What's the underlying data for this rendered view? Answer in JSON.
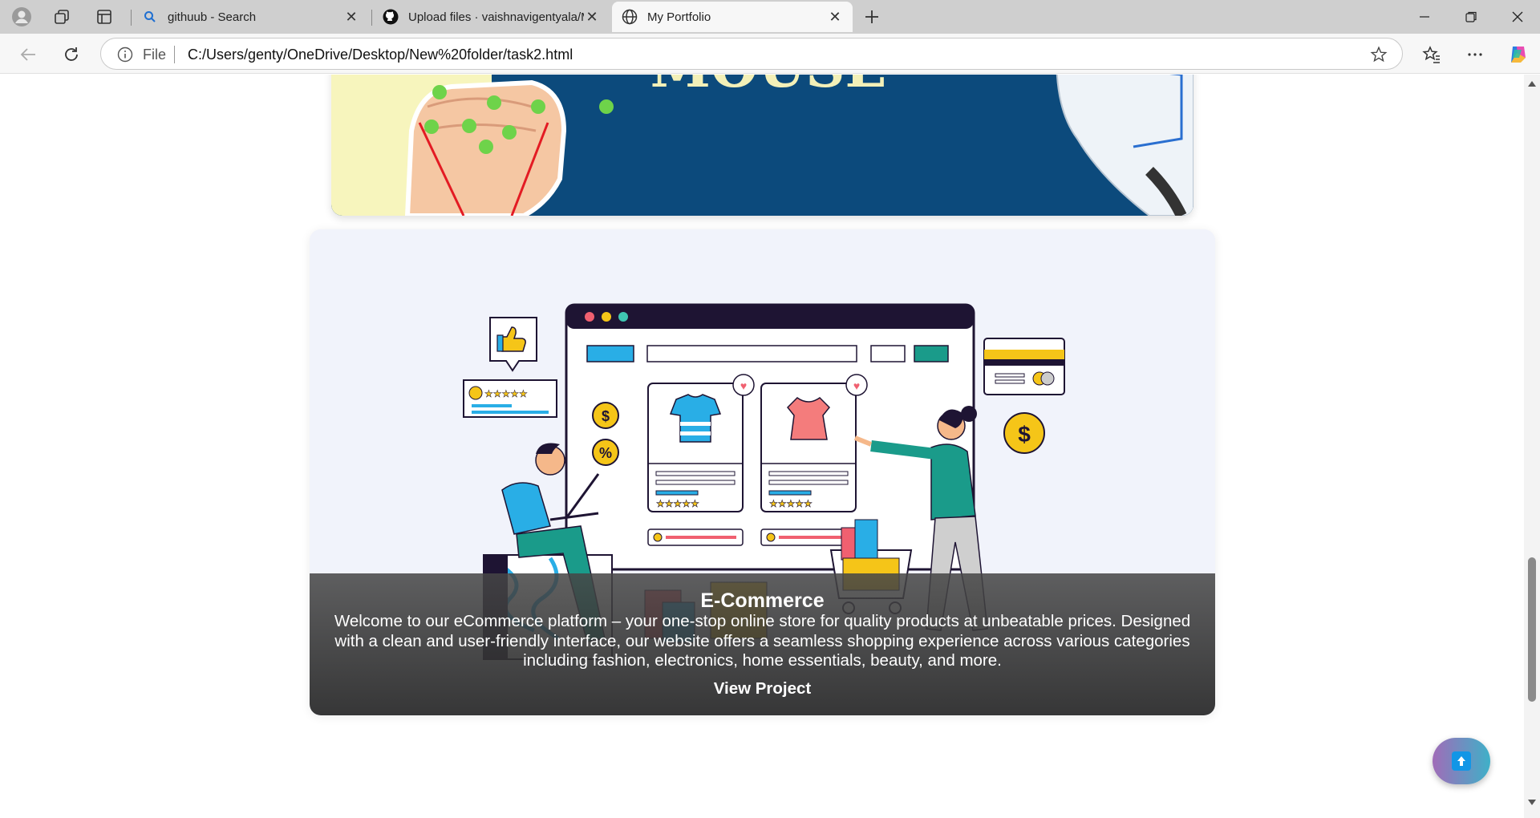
{
  "browser": {
    "tabs": [
      {
        "title": "githuub - Search",
        "icon": "search-icon",
        "active": false
      },
      {
        "title": "Upload files · vaishnavigentyala/M",
        "icon": "github-icon",
        "active": false
      },
      {
        "title": "My Portfolio",
        "icon": "globe-icon",
        "active": true
      }
    ],
    "address": {
      "scheme_label": "File",
      "url": "C:/Users/genty/OneDrive/Desktop/New%20folder/task2.html"
    }
  },
  "page": {
    "top_card": {
      "image_text": "MOUSE"
    },
    "project_card": {
      "title": "E-Commerce",
      "description": "Welcome to our eCommerce platform – your one-stop online store for quality products at unbeatable prices. Designed with a clean and user-friendly interface, our website offers a seamless shopping experience across various categories including fashion, electronics, home essentials, beauty, and more.",
      "link_label": "View Project",
      "illustration_symbols": {
        "dollar": "$",
        "percent": "%"
      }
    },
    "scroll_top_icon": "arrow-up-icon"
  },
  "colors": {
    "tab_strip": "#cfcfcf",
    "card_overlay": "#3f3f3f",
    "accent_blue": "#29aee6",
    "accent_teal": "#1a9b8a",
    "accent_yellow": "#f5c518",
    "navy": "#0c4a7c"
  }
}
